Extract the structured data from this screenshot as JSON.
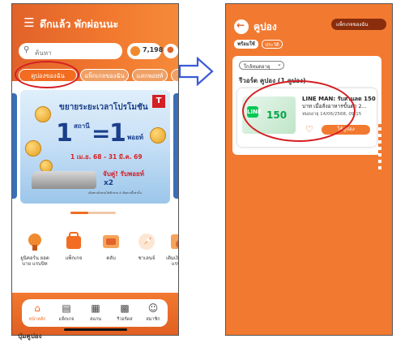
{
  "left": {
    "greeting": "ดึกแล้ว พักผ่อนนะ",
    "search_placeholder": "ค้นหา",
    "points": "7,198",
    "chips": [
      "คูปองของฉัน",
      "แพ็กเกจของฉัน",
      "แลกพอยท์",
      "รหัส"
    ],
    "banner": {
      "headline": "ขยายระยะเวลาโปรโมชัน",
      "big_left": "1",
      "sathani": "สถานี",
      "equals": "=",
      "big_right": "1",
      "point": "พอยท์",
      "dates": "1 เม.ย. 68 - 31 มี.ค. 69",
      "promo": "จับคู่! รับพอยท์",
      "x2": "x2",
      "fine": "เดินทางด้วยรถไฟฟ้าสาย 4 เส้นทางนี้เท่านั้น"
    },
    "services": [
      "ยูนิคอร์น ยอด บาย แรบบิท",
      "แพ็กเกจ",
      "คลับ",
      "ชาเลนจ์",
      "เติมเงิน บัตรแรบบิท"
    ],
    "nav": [
      "หน้าหลัก",
      "แพ็กเกจ",
      "สแกน",
      "รีวอร์ดส",
      "สมาชิก"
    ],
    "caption": "ปุ่มคูปอง"
  },
  "right": {
    "title": "คูปอง",
    "package_button": "แพ็กเกจของฉัน",
    "tabs": [
      "พร้อมใช้",
      "ประวัติ"
    ],
    "filter": "ใกล้หมดอายุ",
    "section": "รีวอร์ด คูปอง (1 คูปอง)",
    "coupon": {
      "logo": "LINE",
      "value": "150",
      "brand": "LINE MAN: รับส่วนลด 150",
      "desc": "บาท เมื่อสั่งอาหารขั้นต่ำ 2...",
      "expiry": "หมดอายุ 14/06/2568, 09:15",
      "use": "ใช้คูปอง"
    }
  },
  "colors": {
    "brand_orange": "#f27a30",
    "annotation_red": "#d41f24",
    "arrow_blue": "#3b5bd6"
  },
  "icons": {
    "menu": "menu-icon",
    "search": "search-icon",
    "bell": "bell-icon",
    "back": "back-arrow-icon",
    "heart": "heart-icon",
    "nav": [
      "home-icon",
      "package-icon",
      "scan-icon",
      "gift-icon",
      "profile-icon"
    ]
  }
}
